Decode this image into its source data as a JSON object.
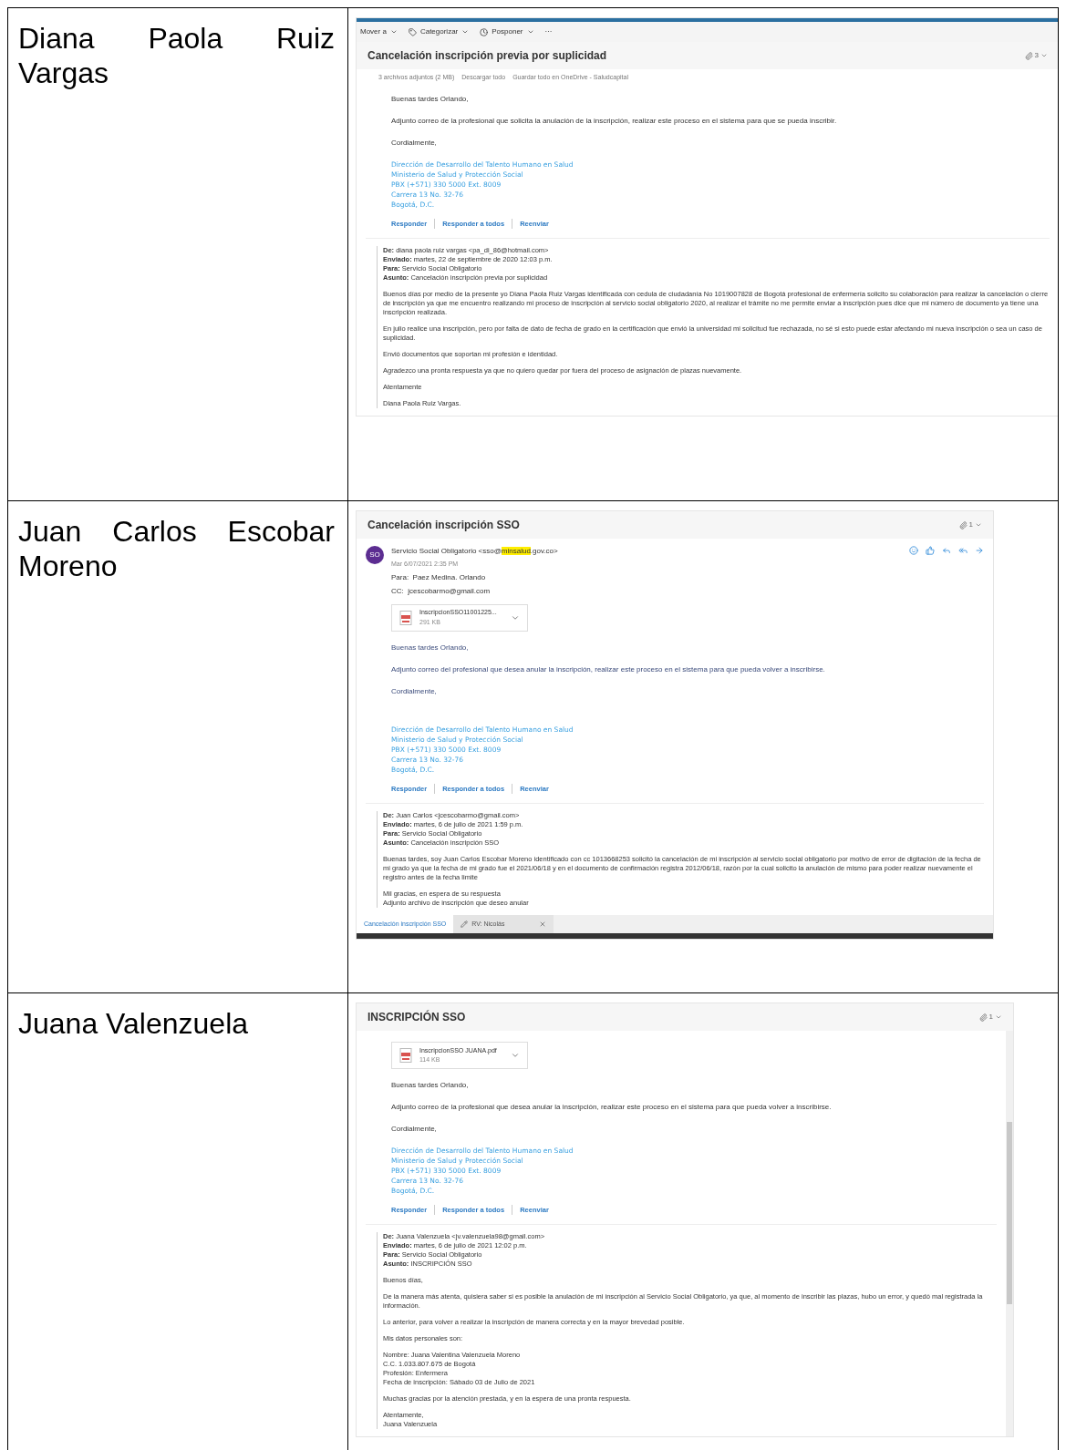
{
  "rows": [
    {
      "name": "Diana Paola Ruiz Vargas",
      "email": {
        "toolbar": [
          "Mover a",
          "Categorizar",
          "Posponer",
          "···"
        ],
        "subject": "Cancelación inscripción previa por suplicidad",
        "attachment_count": "3",
        "attachments_summary": [
          "3 archivos adjuntos (2 MB)",
          "Descargar todo",
          "Guardar todo en OneDrive - Saludcapital"
        ],
        "body": [
          "Buenas tardes Orlando,",
          "Adjunto correo de la profesional que solicita la anulación de la inscripción, realizar este proceso en el sistema para que se pueda inscribir.",
          "Cordialmente,"
        ],
        "signature": [
          "Dirección de Desarrollo del Talento Humano en Salud",
          "Ministerio de Salud y Protección Social",
          "PBX (+571) 330 5000 Ext. 8009",
          "Carrera 13 No. 32-76",
          "Bogotá, D.C."
        ],
        "reply_actions": [
          "Responder",
          "Responder a todos",
          "Reenviar"
        ],
        "quoted_headers": [
          {
            "label": "De:",
            "value": "diana paola ruiz vargas <pa_di_86@hotmail.com>"
          },
          {
            "label": "Enviado:",
            "value": "martes, 22 de septiembre de 2020 12:03 p.m."
          },
          {
            "label": "Para:",
            "value": "Servicio Social Obligatorio"
          },
          {
            "label": "Asunto:",
            "value": "Cancelación inscripción previa por suplicidad"
          }
        ],
        "quoted_paragraphs": [
          "Buenos días por medio de la presente yo Diana Paola Ruiz Vargas identificada con cedula de ciudadanía No 1019007828 de Bogotá profesional de enfermería solicito su colaboración para realizar la cancelación o cierre de inscripción ya que me encuentro realizando mi proceso de inscripción al servicio social obligatorio 2020, al realizar el trámite no me permite enviar a inscripción pues dice que mi número de documento ya tiene una inscripción realizada.",
          "En julio realice una inscripción, pero por falta de dato de fecha de grado en la certificación que envió la universidad mi solicitud fue rechazada, no sé si esto puede estar afectando mi nueva inscripción o sea un caso de suplicidad.",
          "Envió documentos que soportan mi profesión e identidad.",
          "Agradezco una pronta respuesta ya que no quiero quedar por fuera del proceso de asignación de plazas nuevamente.",
          "Atentamente",
          "Diana Paola Ruiz Vargas."
        ]
      }
    },
    {
      "name": "Juan Carlos Escobar Moreno",
      "email": {
        "subject": "Cancelación inscripción SSO",
        "attachment_count": "1",
        "sender": {
          "initials": "SO",
          "name_parts": [
            "Servicio Social Obligatorio <sso@",
            "minsalud",
            ".gov.co>"
          ],
          "date": "Mar 6/07/2021 2:35 PM",
          "to": "Para:  Paez Medina. Orlando",
          "cc": "CC:  jcescobarmo@gmail.com"
        },
        "file": {
          "name": "InscripcionSSO11001225...",
          "size": "291 KB"
        },
        "body": [
          "Buenas tardes Orlando,",
          "Adjunto correo del profesional que desea anular la inscripción, realizar este proceso en el sistema para que pueda volver a inscribirse.",
          "Cordialmente,"
        ],
        "signature": [
          "Dirección de Desarrollo del Talento Humano en Salud",
          "Ministerio de Salud y Protección Social",
          "PBX (+571) 330 5000 Ext. 8009",
          "Carrera 13 No. 32-76",
          "Bogotá, D.C."
        ],
        "reply_actions": [
          "Responder",
          "Responder a todos",
          "Reenviar"
        ],
        "quoted_headers": [
          {
            "label": "De:",
            "value": "Juan Carlos <jcescobarmo@gmail.com>"
          },
          {
            "label": "Enviado:",
            "value": "martes, 6 de julio de 2021 1:59 p.m."
          },
          {
            "label": "Para:",
            "value": "Servicio Social Obligatorio"
          },
          {
            "label": "Asunto:",
            "value": "Cancelación inscripción SSO"
          }
        ],
        "quoted_paragraphs": [
          "Buenas tardes, soy Juan Carlos Escobar Moreno identificado con cc 1013668253 solicitó la cancelación de mi inscripción al servicio social obligatorio por motivo de error de digitación de la fecha de mi grado ya que  la fecha de mi grado fue el 2021/06/18 y en el documento de confirmación registra 2012/06/18, razón por la cual solicito la anulación de mismo para poder realizar nuevamente el registro antes de la fecha limite",
          "Mil gracias, en espera de su respuesta\nAdjunto archivo de inscripción que deseo anular"
        ],
        "tabs": [
          {
            "label": "Cancelación inscripción SSO",
            "selected": true,
            "kind": "read"
          },
          {
            "label": "RV: Nicolás",
            "selected": false,
            "kind": "draft"
          }
        ]
      }
    },
    {
      "name": "Juana Valenzuela",
      "email": {
        "subject": "INSCRIPCIÓN SSO",
        "attachment_count": "1",
        "file": {
          "name": "InscripcionSSO JUANA.pdf",
          "size": "114 KB"
        },
        "body": [
          "Buenas tardes Orlando,",
          "Adjunto correo de la profesional que desea anular la inscripción, realizar este proceso en el sistema para que pueda volver a inscribirse.",
          "Cordialmente,"
        ],
        "signature": [
          "Dirección de Desarrollo del Talento Humano en Salud",
          "Ministerio de Salud y Protección Social",
          "PBX (+571) 330 5000 Ext. 8009",
          "Carrera 13 No. 32-76",
          "Bogotá, D.C."
        ],
        "reply_actions": [
          "Responder",
          "Responder a todos",
          "Reenviar"
        ],
        "quoted_headers": [
          {
            "label": "De:",
            "value": "Juana Valenzuela <jv.valenzuela98@gmail.com>"
          },
          {
            "label": "Enviado:",
            "value": "martes, 6 de julio de 2021 12:02 p.m."
          },
          {
            "label": "Para:",
            "value": "Servicio Social Obligatorio"
          },
          {
            "label": "Asunto:",
            "value": "INSCRIPCIÓN SSO"
          }
        ],
        "quoted_paragraphs": [
          "Buenos días,",
          "De la manera más atenta, quisiera saber si es posible la anulación de mi inscripción  al Servicio Social Obligatorio, ya que, al momento de inscribir las plazas, hubo un error, y quedó mal registrada la información.",
          "Lo anterior, para volver a realizar la inscripción de manera correcta y en la mayor brevedad posible.",
          "Mis datos personales son:",
          "Nombre: Juana Valentina Valenzuela Moreno\nC.C. 1.033.807.675 de Bogotá\nProfesión: Enfermera\nFecha de inscripción: Sábado 03 de Julio de 2021",
          "Muchas gracias por la atención prestada, y en la espera de una pronta respuesta.",
          "Atentamente,\nJuana Valenzuela"
        ]
      }
    }
  ]
}
